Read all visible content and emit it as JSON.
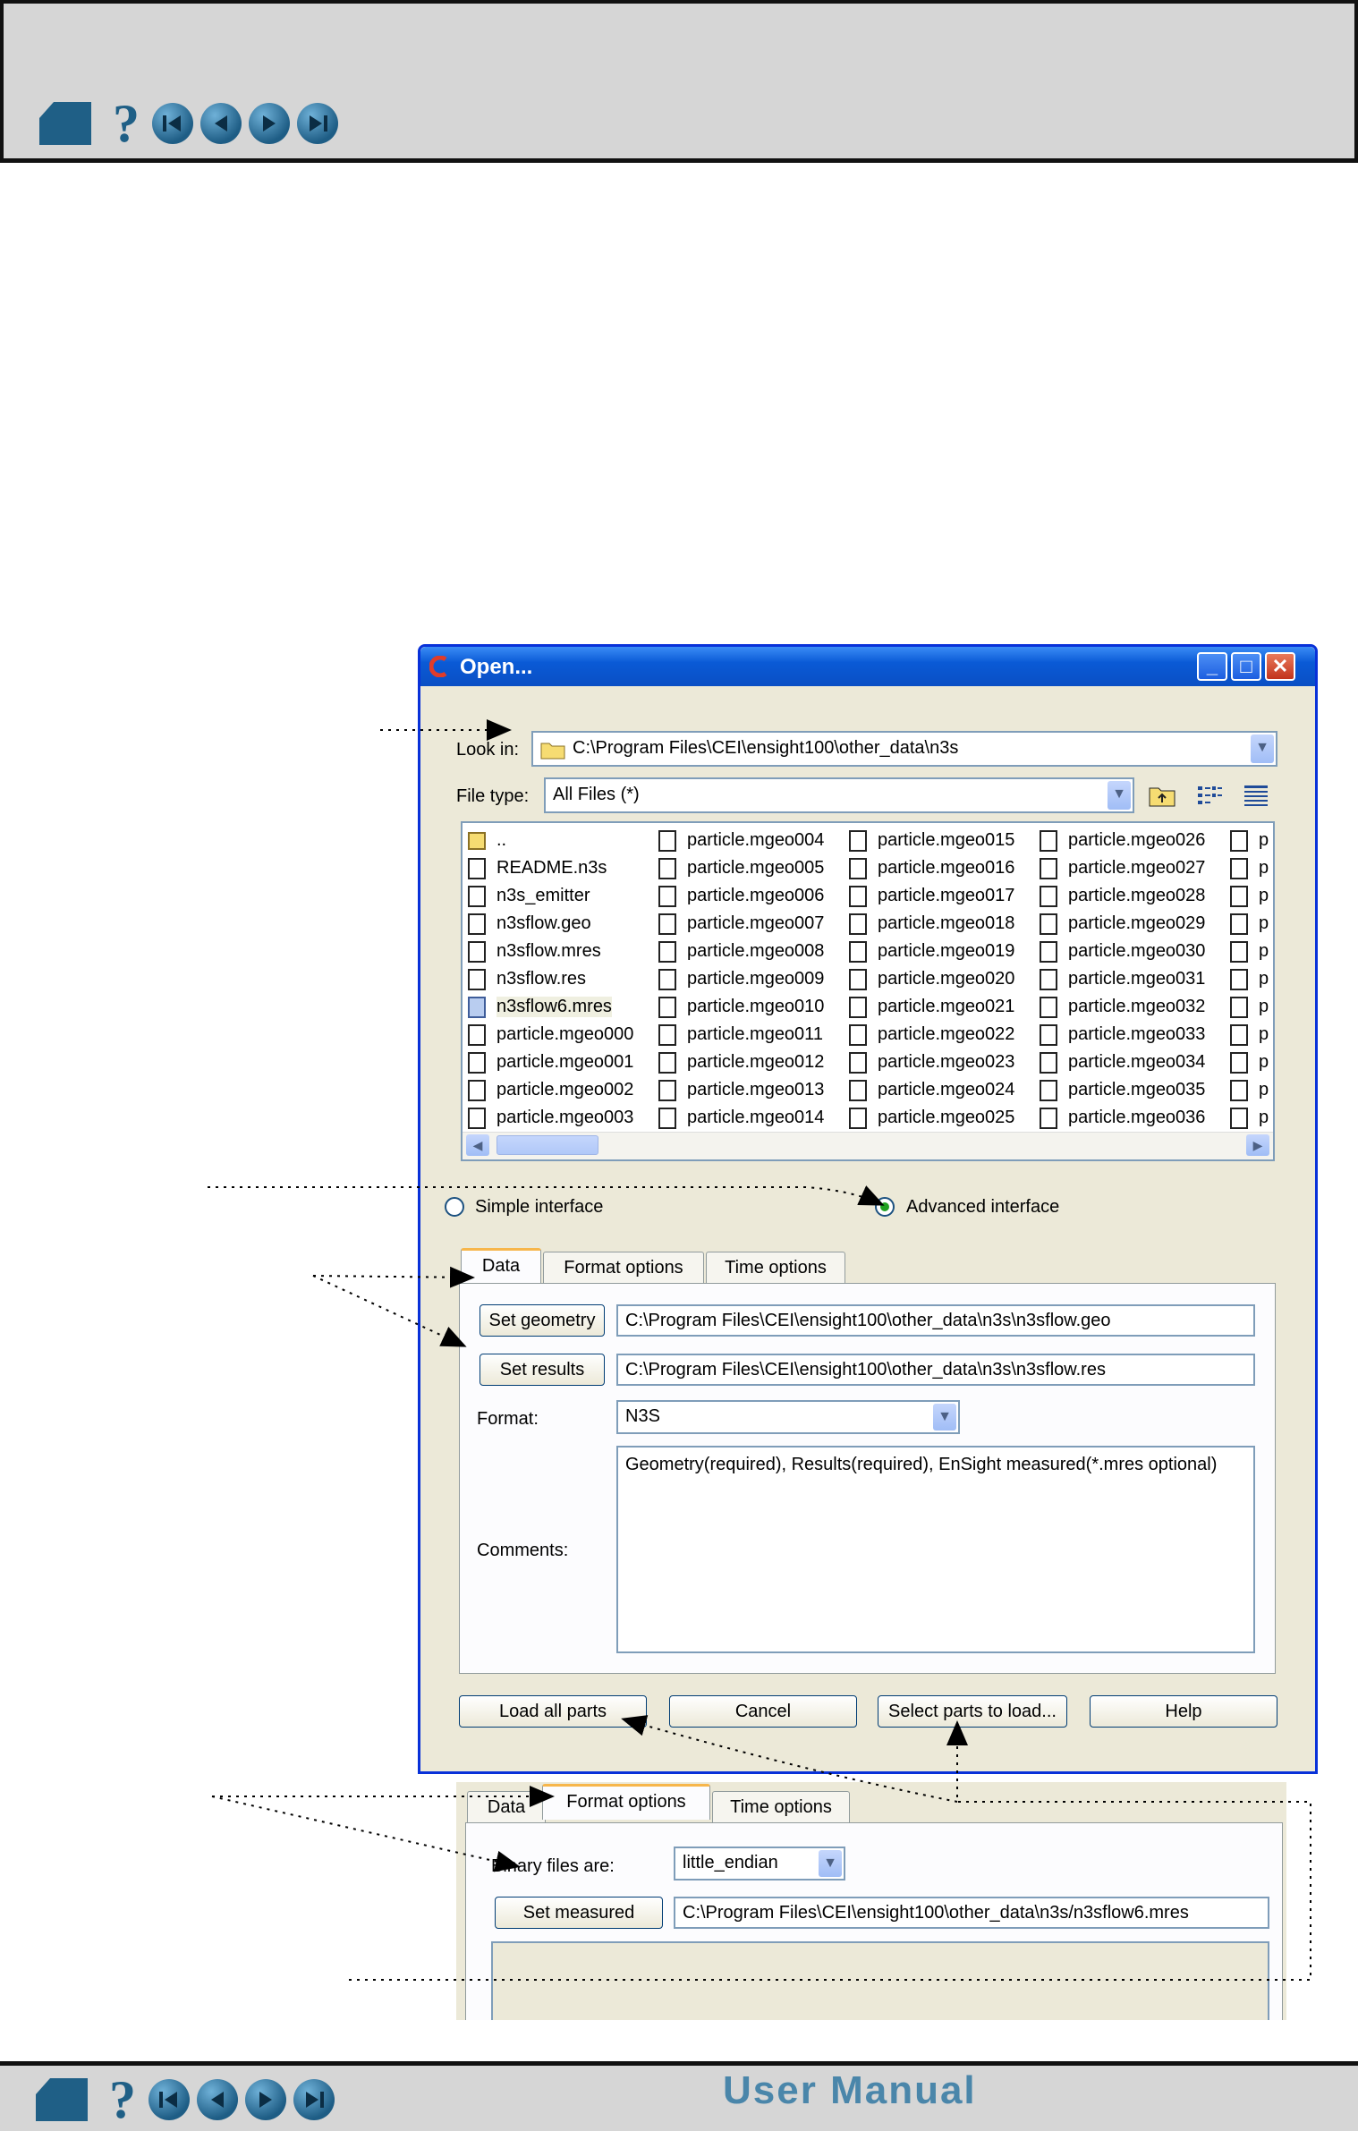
{
  "header": {
    "nav_icons": [
      "home-icon",
      "help-icon",
      "first-page-icon",
      "prev-page-icon",
      "next-page-icon",
      "last-page-icon"
    ]
  },
  "footer": {
    "title": "User Manual"
  },
  "dialog": {
    "title": "Open...",
    "title_buttons": [
      "minimize",
      "maximize",
      "close"
    ],
    "look_in_label": "Look in:",
    "look_in_value": "C:\\Program Files\\CEI\\ensight100\\other_data\\n3s",
    "file_type_label": "File type:",
    "file_type_value": "All Files (*)",
    "files": {
      "col1": [
        "..",
        "README.n3s",
        "n3s_emitter",
        "n3sflow.geo",
        "n3sflow.mres",
        "n3sflow.res",
        "n3sflow6.mres",
        "particle.mgeo000",
        "particle.mgeo001",
        "particle.mgeo002",
        "particle.mgeo003"
      ],
      "col2": [
        "particle.mgeo004",
        "particle.mgeo005",
        "particle.mgeo006",
        "particle.mgeo007",
        "particle.mgeo008",
        "particle.mgeo009",
        "particle.mgeo010",
        "particle.mgeo011",
        "particle.mgeo012",
        "particle.mgeo013",
        "particle.mgeo014"
      ],
      "col3": [
        "particle.mgeo015",
        "particle.mgeo016",
        "particle.mgeo017",
        "particle.mgeo018",
        "particle.mgeo019",
        "particle.mgeo020",
        "particle.mgeo021",
        "particle.mgeo022",
        "particle.mgeo023",
        "particle.mgeo024",
        "particle.mgeo025"
      ],
      "col4": [
        "particle.mgeo026",
        "particle.mgeo027",
        "particle.mgeo028",
        "particle.mgeo029",
        "particle.mgeo030",
        "particle.mgeo031",
        "particle.mgeo032",
        "particle.mgeo033",
        "particle.mgeo034",
        "particle.mgeo035",
        "particle.mgeo036"
      ],
      "col5": [
        "p",
        "p",
        "p",
        "p",
        "p",
        "p",
        "p",
        "p",
        "p",
        "p",
        "p"
      ]
    },
    "radio_simple": "Simple interface",
    "radio_advanced": "Advanced interface",
    "advanced_selected": true,
    "tabs": [
      "Data",
      "Format options",
      "Time options"
    ],
    "set_geometry_label": "Set geometry",
    "geometry_path": "C:\\Program Files\\CEI\\ensight100\\other_data\\n3s\\n3sflow.geo",
    "set_results_label": "Set results",
    "results_path": "C:\\Program Files\\CEI\\ensight100\\other_data\\n3s\\n3sflow.res",
    "format_label": "Format:",
    "format_value": "N3S",
    "comments_label": "Comments:",
    "comments_value": "Geometry(required), Results(required), EnSight measured(*.mres optional)",
    "buttons": {
      "load_all": "Load all parts",
      "cancel": "Cancel",
      "select_parts": "Select parts to load...",
      "help": "Help"
    }
  },
  "format_fragment": {
    "tabs": [
      "Data",
      "Format options",
      "Time options"
    ],
    "binary_label": "Binary files are:",
    "binary_value": "little_endian",
    "set_measured_label": "Set measured",
    "measured_path": "C:\\Program Files\\CEI\\ensight100\\other_data\\n3s/n3sflow6.mres"
  },
  "colors": {
    "accent": "#0a5ad6",
    "dialog_bg": "#ece9d8",
    "nav_blue": "#1f5f86"
  }
}
